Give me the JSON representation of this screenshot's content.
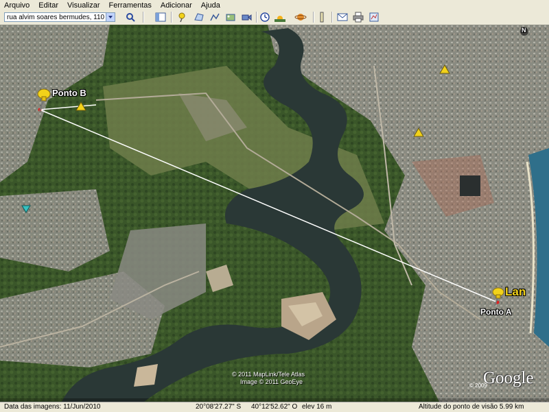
{
  "menubar": {
    "items": [
      "Arquivo",
      "Editar",
      "Visualizar",
      "Ferramentas",
      "Adicionar",
      "Ajuda"
    ]
  },
  "toolbar": {
    "search_value": "rua alvim soares bermudes, 110",
    "buttons": [
      "search-icon",
      "sidebar-icon",
      "placemark-icon",
      "polygon-icon",
      "path-icon",
      "image-overlay-icon",
      "record-tour-icon",
      "historical-imagery-icon",
      "sunlight-icon",
      "planets-icon",
      "ruler-icon",
      "email-icon",
      "print-icon",
      "view-in-maps-icon"
    ]
  },
  "map": {
    "compass": "N",
    "placemarks": [
      {
        "label": "Ponto B",
        "icon": "yellow-pushpin-icon"
      },
      {
        "label": "Ponto A",
        "icon": "yellow-pushpin-icon"
      },
      {
        "label": "Lan",
        "icon": "yellow-pushpin-icon"
      }
    ],
    "copyright_1": "© 2011 MapLink/Tele Atlas",
    "copyright_2": "Image © 2011 GeoEye",
    "logo": "Google",
    "logo_year": "© 2009"
  },
  "statusbar": {
    "date": "Data das imagens: 11/Jun/2010",
    "lat": "20°08'27.27\" S",
    "lon": "40°12'52.62\" O",
    "elev": "elev    16 m",
    "eye_alt": "Altitude do ponto de visão    5.99 km"
  },
  "colors": {
    "ui_bg": "#ece9d8",
    "forest": "#3b5a2a",
    "water": "#2a3a38",
    "urban": "#9a9a92",
    "ocean": "#2f6f8a",
    "measure_line": "#ffffff",
    "pin": "#f2d21a"
  }
}
